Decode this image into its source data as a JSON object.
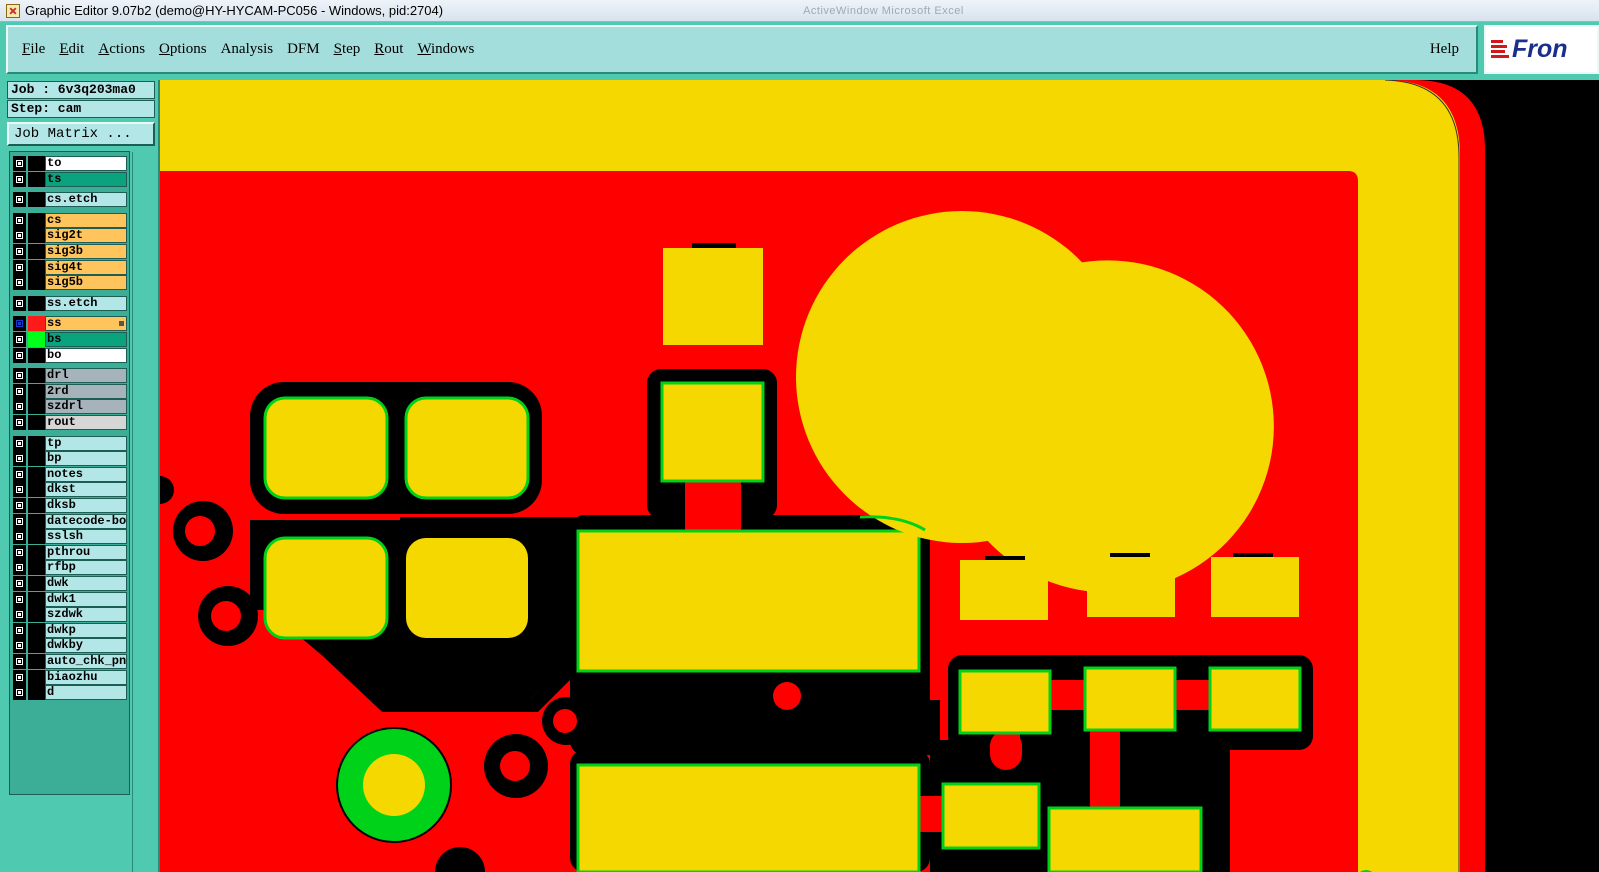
{
  "window": {
    "title": "Graphic Editor 9.07b2 (demo@HY-HYCAM-PC056 - Windows, pid:2704)",
    "background_text": "ActiveWindow  Microsoft Excel"
  },
  "menu": {
    "items": [
      {
        "label": "File",
        "mnemonic": "F",
        "rest": "ile"
      },
      {
        "label": "Edit",
        "mnemonic": "E",
        "rest": "dit"
      },
      {
        "label": "Actions",
        "mnemonic": "A",
        "rest": "ctions"
      },
      {
        "label": "Options",
        "mnemonic": "O",
        "rest": "ptions"
      },
      {
        "label": "Analysis",
        "mnemonic": "",
        "rest": "Analysis"
      },
      {
        "label": "DFM",
        "mnemonic": "",
        "rest": "DFM"
      },
      {
        "label": "Step",
        "mnemonic": "S",
        "rest": "tep"
      },
      {
        "label": "Rout",
        "mnemonic": "R",
        "rest": "out"
      },
      {
        "label": "Windows",
        "mnemonic": "W",
        "rest": "indows"
      }
    ],
    "help": "Help"
  },
  "logo": {
    "text": "Fron",
    "icon": "frontline-logo-icon"
  },
  "job": {
    "label": "Job : 6v3q203ma0",
    "step": "Step: cam",
    "matrix_button": "Job Matrix ..."
  },
  "layers": [
    {
      "name": "to",
      "bg": "#ffffff",
      "sel": false,
      "color": "#000000"
    },
    {
      "name": "ts",
      "bg": "#0aa37e",
      "sel": false,
      "color": "#000000"
    },
    {
      "name": "cs.etch",
      "bg": "#b3e6e6",
      "sel": false,
      "color": "#000000",
      "gap": true
    },
    {
      "name": "cs",
      "bg": "#ffc45c",
      "sel": false,
      "color": "#000000",
      "gap": true
    },
    {
      "name": "sig2t",
      "bg": "#ffc45c",
      "sel": false,
      "color": "#000000"
    },
    {
      "name": "sig3b",
      "bg": "#ffc45c",
      "sel": false,
      "color": "#000000"
    },
    {
      "name": "sig4t",
      "bg": "#ffc45c",
      "sel": false,
      "color": "#000000"
    },
    {
      "name": "sig5b",
      "bg": "#ffc45c",
      "sel": false,
      "color": "#000000"
    },
    {
      "name": "ss.etch",
      "bg": "#b3e6e6",
      "sel": false,
      "color": "#000000",
      "gap": true
    },
    {
      "name": "ss",
      "bg": "#ffc45c",
      "sel": true,
      "color": "#ff1a1a",
      "gap": true,
      "dot": true
    },
    {
      "name": "bs",
      "bg": "#0aa37e",
      "sel": false,
      "color": "#00ff1a"
    },
    {
      "name": "bo",
      "bg": "#ffffff",
      "sel": false,
      "color": "#000000"
    },
    {
      "name": "drl",
      "bg": "#a6b3bb",
      "sel": false,
      "color": "#000000",
      "gap": true
    },
    {
      "name": "2rd",
      "bg": "#a6b3bb",
      "sel": false,
      "color": "#000000"
    },
    {
      "name": "szdrl",
      "bg": "#a6b3bb",
      "sel": false,
      "color": "#000000"
    },
    {
      "name": "rout",
      "bg": "#d6d6d6",
      "sel": false,
      "color": "#000000"
    },
    {
      "name": "tp",
      "bg": "#b3e6e6",
      "sel": false,
      "color": "#000000",
      "gap": true
    },
    {
      "name": "bp",
      "bg": "#b3e6e6",
      "sel": false,
      "color": "#000000"
    },
    {
      "name": "notes",
      "bg": "#b3e6e6",
      "sel": false,
      "color": "#000000"
    },
    {
      "name": "dkst",
      "bg": "#b3e6e6",
      "sel": false,
      "color": "#000000"
    },
    {
      "name": "dksb",
      "bg": "#b3e6e6",
      "sel": false,
      "color": "#000000"
    },
    {
      "name": "datecode-bo",
      "bg": "#b3e6e6",
      "sel": false,
      "color": "#000000"
    },
    {
      "name": "sslsh",
      "bg": "#b3e6e6",
      "sel": false,
      "color": "#000000"
    },
    {
      "name": "pthrou",
      "bg": "#b3e6e6",
      "sel": false,
      "color": "#000000"
    },
    {
      "name": "rfbp",
      "bg": "#b3e6e6",
      "sel": false,
      "color": "#000000"
    },
    {
      "name": "dwk",
      "bg": "#b3e6e6",
      "sel": false,
      "color": "#000000"
    },
    {
      "name": "dwk1",
      "bg": "#b3e6e6",
      "sel": false,
      "color": "#000000"
    },
    {
      "name": "szdwk",
      "bg": "#b3e6e6",
      "sel": false,
      "color": "#000000"
    },
    {
      "name": "dwkp",
      "bg": "#b3e6e6",
      "sel": false,
      "color": "#000000"
    },
    {
      "name": "dwkby",
      "bg": "#b3e6e6",
      "sel": false,
      "color": "#000000"
    },
    {
      "name": "auto_chk_pn",
      "bg": "#b3e6e6",
      "sel": false,
      "color": "#000000"
    },
    {
      "name": "biaozhu",
      "bg": "#b3e6e6",
      "sel": false,
      "color": "#000000"
    },
    {
      "name": "d",
      "bg": "#b3e6e6",
      "sel": false,
      "color": "#000000"
    }
  ],
  "colors": {
    "board_red": "#ff0000",
    "pad_yellow": "#f5d800",
    "outline_green": "#00d21a",
    "background_black": "#000000"
  }
}
